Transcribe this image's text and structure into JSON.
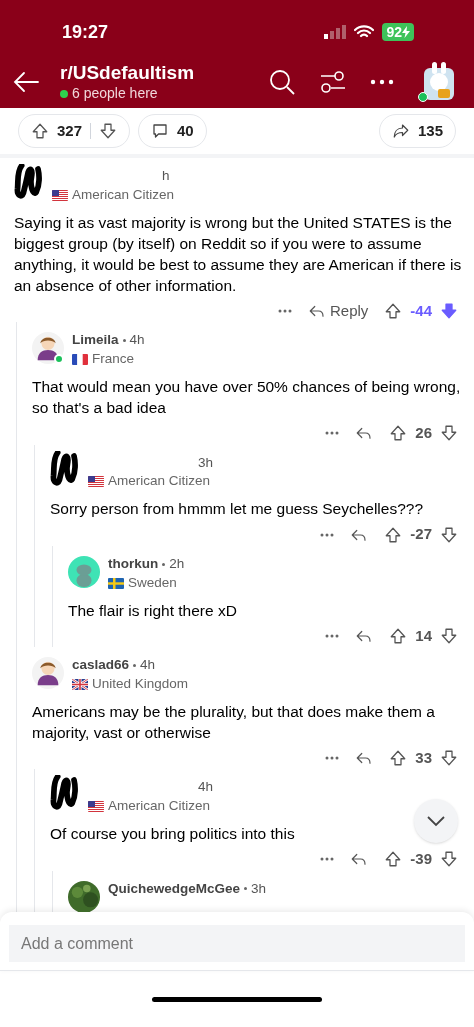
{
  "status_bar": {
    "time": "19:27",
    "battery": "92"
  },
  "header": {
    "title": "r/USdefaultism",
    "presence": "6 people here",
    "online": true
  },
  "post_actions": {
    "upvotes": "327",
    "comments": "40",
    "shares": "135"
  },
  "comments": [
    {
      "redacted": true,
      "time": "h",
      "flair": {
        "kind": "us",
        "text": "American Citizen"
      },
      "online": false,
      "body": "Saying it as vast majority is wrong but the United STATES is the biggest group (by itself) on Reddit so if you were to assume anything, it would be best to assume they are American if there is an absence of other information.",
      "reply_label": "Reply",
      "score": "-44",
      "downvoted": true,
      "children": [
        {
          "redacted": false,
          "author": "Limeila",
          "avatar": {
            "kind": "cartoon"
          },
          "time": "4h",
          "flair": {
            "kind": "fr",
            "text": "France"
          },
          "online": true,
          "body": "That would mean you have over 50% chances of being wrong, so that's a bad idea",
          "score": "26",
          "downvoted": false,
          "children": [
            {
              "redacted": true,
              "time": "3h",
              "flair": {
                "kind": "us",
                "text": "American Citizen"
              },
              "online": false,
              "body": "Sorry person from hmmm let me guess Seychelles???",
              "score": "-27",
              "downvoted": false,
              "children": [
                {
                  "redacted": false,
                  "author": "thorkun",
                  "avatar": {
                    "kind": "snoo"
                  },
                  "time": "2h",
                  "flair": {
                    "kind": "se",
                    "text": "Sweden"
                  },
                  "online": false,
                  "body": "The flair is right there xD",
                  "score": "14",
                  "downvoted": false
                }
              ]
            }
          ]
        },
        {
          "redacted": false,
          "author": "caslad66",
          "avatar": {
            "kind": "cartoon"
          },
          "time": "4h",
          "flair": {
            "kind": "uk",
            "text": "United Kingdom"
          },
          "online": false,
          "body": "Americans may be the plurality, but that does make them a majority, vast or otherwise",
          "score": "33",
          "downvoted": false,
          "children": [
            {
              "redacted": true,
              "time": "4h",
              "flair": {
                "kind": "us",
                "text": "American Citizen"
              },
              "online": false,
              "body": "Of course you bring politics into this",
              "score": "-39",
              "downvoted": false,
              "children": [
                {
                  "redacted": false,
                  "author": "QuichewedgeMcGee",
                  "time": "3h",
                  "online": false
                }
              ]
            }
          ]
        }
      ]
    }
  ],
  "composer": {
    "placeholder": "Add a comment"
  }
}
